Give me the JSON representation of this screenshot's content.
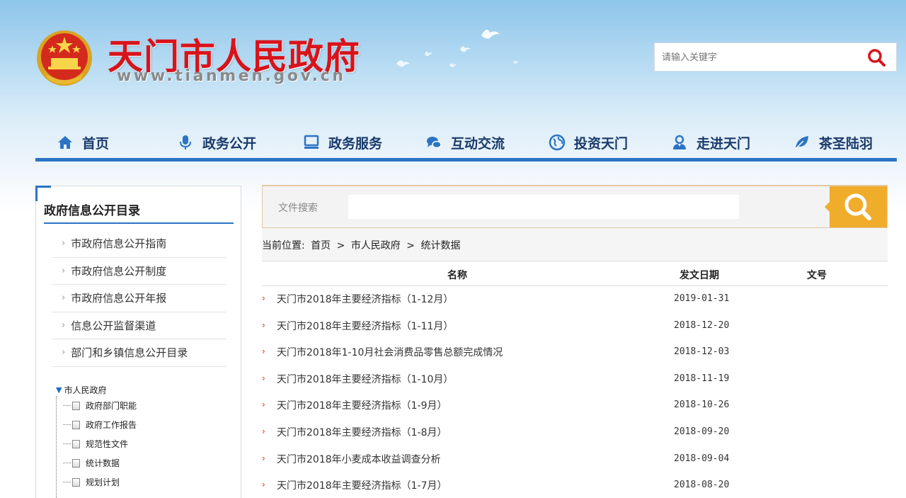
{
  "header": {
    "site_title": "天门市人民政府",
    "site_url": "www.tianmen.gov.cn",
    "search_placeholder": "请输入关键字"
  },
  "nav": [
    {
      "label": "首页",
      "icon": "home-icon"
    },
    {
      "label": "政务公开",
      "icon": "microphone-icon"
    },
    {
      "label": "政务服务",
      "icon": "computer-icon"
    },
    {
      "label": "互动交流",
      "icon": "chat-icon"
    },
    {
      "label": "投资天门",
      "icon": "globe-icon"
    },
    {
      "label": "走进天门",
      "icon": "person-icon"
    },
    {
      "label": "茶圣陆羽",
      "icon": "leaf-icon"
    }
  ],
  "sidebar": {
    "title": "政府信息公开目录",
    "links": [
      "市政府信息公开指南",
      "市政府信息公开制度",
      "市政府信息公开年报",
      "信息公开监督渠道",
      "部门和乡镇信息公开目录"
    ],
    "tree_root": "市人民政府",
    "tree_items": [
      "政府部门职能",
      "政府工作报告",
      "规范性文件",
      "统计数据",
      "规划计划"
    ]
  },
  "main": {
    "search_label": "文件搜索",
    "breadcrumb": {
      "prefix": "当前位置:",
      "items": [
        "首页",
        "市人民政府",
        "统计数据"
      ],
      "sep": ">"
    },
    "table": {
      "headers": [
        "名称",
        "发文日期",
        "文号"
      ],
      "rows": [
        {
          "title": "天门市2018年主要经济指标（1-12月）",
          "date": "2019-01-31",
          "num": ""
        },
        {
          "title": "天门市2018年主要经济指标（1-11月）",
          "date": "2018-12-20",
          "num": ""
        },
        {
          "title": "天门市2018年1-10月社会消费品零售总额完成情况",
          "date": "2018-12-03",
          "num": ""
        },
        {
          "title": "天门市2018年主要经济指标（1-10月）",
          "date": "2018-11-19",
          "num": ""
        },
        {
          "title": "天门市2018年主要经济指标（1-9月）",
          "date": "2018-10-26",
          "num": ""
        },
        {
          "title": "天门市2018年主要经济指标（1-8月）",
          "date": "2018-09-20",
          "num": ""
        },
        {
          "title": "天门市2018年小麦成本收益调查分析",
          "date": "2018-09-04",
          "num": ""
        },
        {
          "title": "天门市2018年主要经济指标（1-7月）",
          "date": "2018-08-20",
          "num": ""
        }
      ]
    }
  },
  "colors": {
    "title_red": "#d8131b",
    "nav_blue": "#2b74c4",
    "search_orange": "#f0ad2c",
    "row_marker_red": "#e0211b"
  }
}
